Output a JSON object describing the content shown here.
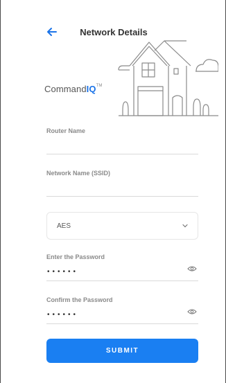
{
  "header": {
    "title": "Network Details"
  },
  "brand": {
    "name_prefix": "Command",
    "name_suffix": "IQ",
    "trademark": "TM"
  },
  "form": {
    "router_name": {
      "label": "Router Name",
      "value": ""
    },
    "network_name": {
      "label": "Network Name (SSID)",
      "value": ""
    },
    "encryption": {
      "selected": "AES"
    },
    "password": {
      "label": "Enter the Password",
      "masked": "••••••"
    },
    "confirm_password": {
      "label": "Confirm the Password",
      "masked": "••••••"
    },
    "submit_label": "SUBMIT"
  },
  "colors": {
    "accent": "#1a7ff2",
    "back_arrow": "#1a73e8",
    "label": "#8a8a8a",
    "divider": "#d9d9d9"
  }
}
